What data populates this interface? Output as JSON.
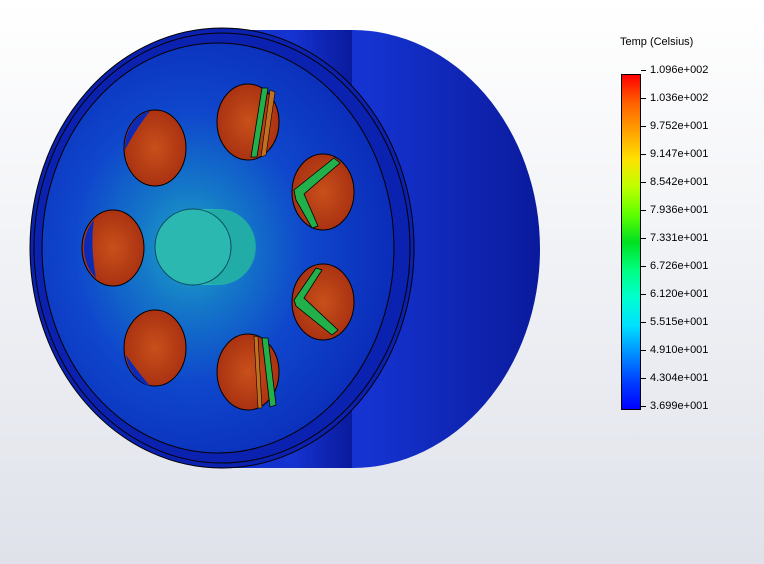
{
  "legend": {
    "title": "Temp (Celsius)",
    "labels": [
      "1.096e+002",
      "1.036e+002",
      "9.752e+001",
      "9.147e+001",
      "8.542e+001",
      "7.936e+001",
      "7.331e+001",
      "6.726e+001",
      "6.120e+001",
      "5.515e+001",
      "4.910e+001",
      "4.304e+001",
      "3.699e+001"
    ],
    "colors": [
      "#ff0000",
      "#ff6000",
      "#ffa000",
      "#ffe000",
      "#c0ff00",
      "#60ff00",
      "#00e020",
      "#00ff80",
      "#00ffd0",
      "#00e0ff",
      "#0090ff",
      "#0040ff",
      "#0000ff"
    ]
  },
  "model": {
    "hole_count": 7,
    "colors": {
      "outer_shell": "#0a1fb8",
      "face": "#0c3bd6",
      "center_glow": "#1fa0c8",
      "hot_hole": "#c03a10",
      "boss": "#22b8b0",
      "green_strip": "#21b04a"
    }
  }
}
